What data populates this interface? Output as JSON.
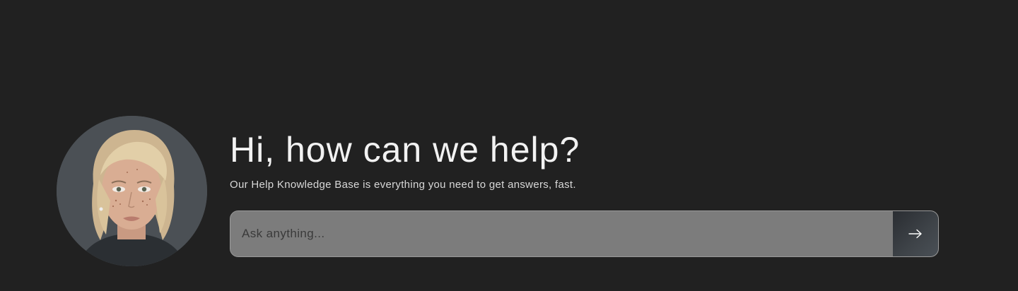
{
  "hero": {
    "title": "Hi, how can we help?",
    "subtitle": "Our Help Knowledge Base is everything you need to get answers, fast.",
    "avatar_icon": "person-portrait-avatar"
  },
  "search": {
    "placeholder": "Ask anything...",
    "value": "",
    "submit_icon": "arrow-right-icon",
    "submit_label": "Submit question"
  },
  "colors": {
    "background": "#212121",
    "search_field": "#7c7c7c",
    "search_border": "#9a9a9a",
    "button": "#3a3f44",
    "text_primary": "#f2f2f2",
    "text_secondary": "#d8d8d8"
  }
}
